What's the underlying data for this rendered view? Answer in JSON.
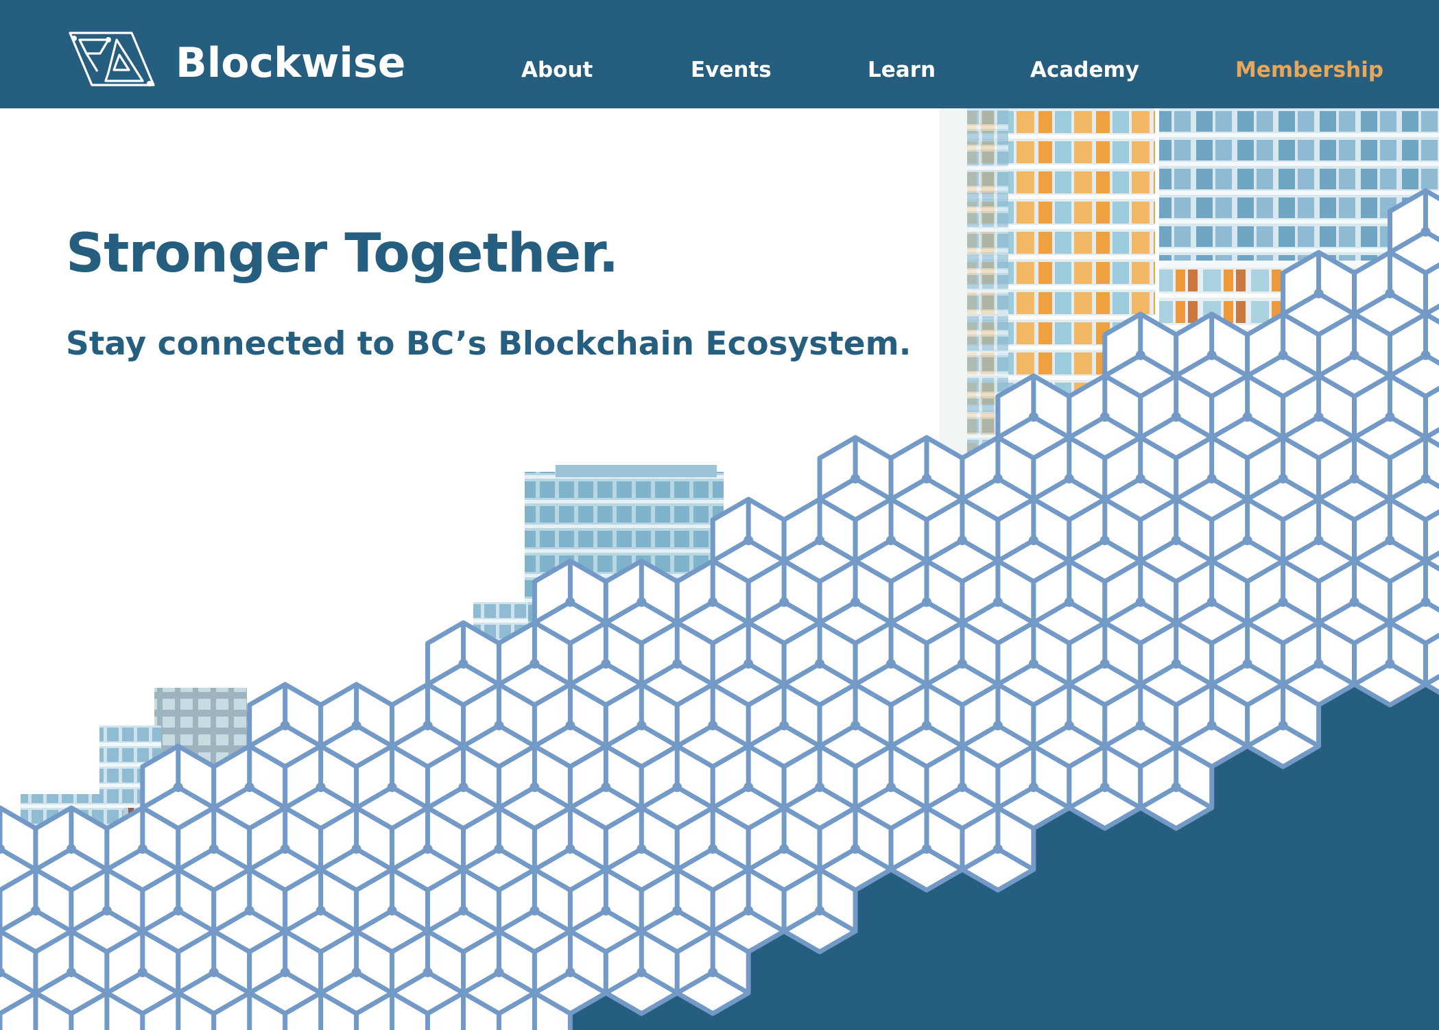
{
  "header": {
    "brand": "Blockwise",
    "logo_icon": "blockwise-triangle-logo-icon",
    "nav": [
      {
        "label": "About"
      },
      {
        "label": "Events"
      },
      {
        "label": "Learn"
      },
      {
        "label": "Academy"
      },
      {
        "label": "Membership",
        "highlight": true
      }
    ]
  },
  "hero": {
    "title": "Stronger Together.",
    "subtitle": "Stay connected to BC’s Blockchain Ecosystem."
  },
  "colors": {
    "brand_blue": "#255e7e",
    "accent_orange": "#e8a65a",
    "hex_stroke": "#7399c6",
    "white": "#ffffff"
  }
}
